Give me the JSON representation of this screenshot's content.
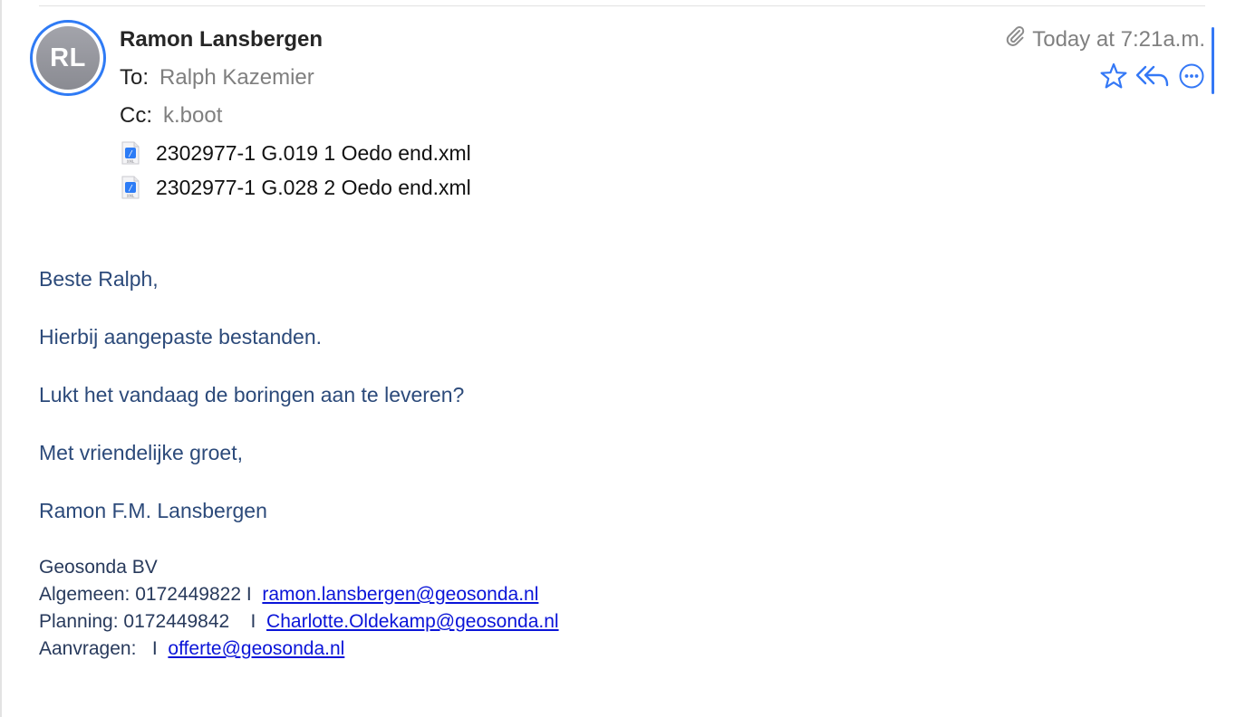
{
  "message": {
    "avatar_initials": "RL",
    "sender_name": "Ramon Lansbergen",
    "to_label": "To:",
    "to_value": "Ralph Kazemier",
    "cc_label": "Cc:",
    "cc_value": "k.boot",
    "date": "Today at 7:21a.m.",
    "attachments": [
      {
        "name": "2302977-1 G.019 1 Oedo end.xml",
        "icon": "xml-file-icon",
        "icon_label": "XML"
      },
      {
        "name": "2302977-1 G.028 2 Oedo end.xml",
        "icon": "xml-file-icon",
        "icon_label": "XML"
      }
    ]
  },
  "actions": {
    "flag": "star-icon",
    "reply": "reply-all-icon",
    "more": "more-icon",
    "attachment_indicator": "paperclip-icon"
  },
  "body": {
    "greeting": "Beste Ralph,",
    "line1": "Hierbij aangepaste bestanden.",
    "line2": "Lukt het vandaag de boringen aan te leveren?",
    "closing": "Met vriendelijke groet,",
    "name": "Ramon F.M. Lansbergen"
  },
  "signature": {
    "company": "Geosonda BV",
    "algemeen_label": "Algemeen: 0172449822 I  ",
    "algemeen_email": "ramon.lansbergen@geosonda.nl",
    "planning_label": "Planning: 0172449842    I  ",
    "planning_email": "Charlotte.Oldekamp@geosonda.nl",
    "aanvragen_label": "Aanvragen:   I  ",
    "aanvragen_email": "offerte@geosonda.nl"
  },
  "colors": {
    "accent": "#3478f6",
    "body_text": "#2c4a7a",
    "link": "#0a14d8",
    "muted": "#808080"
  }
}
